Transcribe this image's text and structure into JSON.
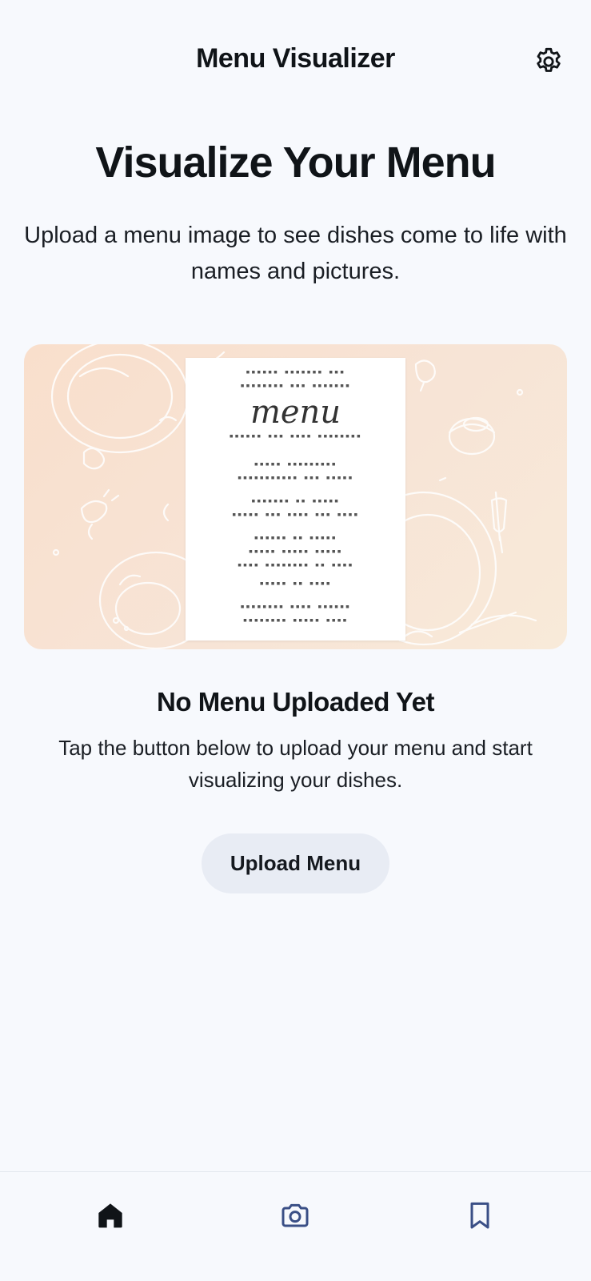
{
  "header": {
    "title": "Menu Visualizer",
    "settings_icon": "gear-icon"
  },
  "hero": {
    "title": "Visualize Your Menu",
    "subtitle": "Upload a menu image to see dishes come to life with names and pictures."
  },
  "illustration": {
    "menu_word": "menu",
    "background_color": "#f9dfcc"
  },
  "empty_state": {
    "title": "No Menu Uploaded Yet",
    "subtitle": "Tap the button below to upload your menu and start visualizing your dishes."
  },
  "upload_button": {
    "label": "Upload Menu"
  },
  "bottom_nav": {
    "items": [
      {
        "icon": "home-icon",
        "active": true
      },
      {
        "icon": "camera-icon",
        "active": false
      },
      {
        "icon": "bookmark-icon",
        "active": false
      }
    ],
    "active_color": "#101418",
    "inactive_color": "#3a4f86"
  }
}
